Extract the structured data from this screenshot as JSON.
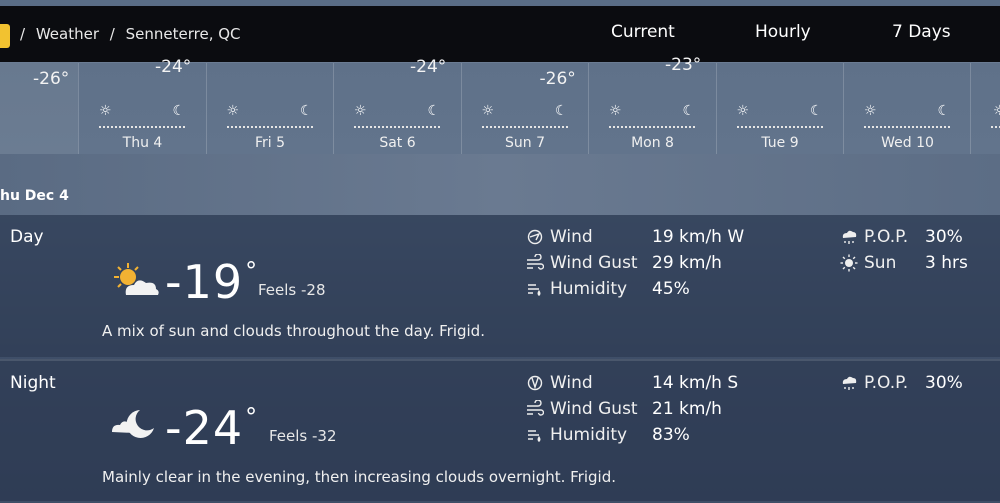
{
  "breadcrumb": {
    "separator": "/",
    "weather": "Weather",
    "location": "Senneterre, QC"
  },
  "nav": {
    "current": "Current",
    "hourly": "Hourly",
    "seven_days": "7 Days"
  },
  "strip": {
    "first_temp": "-26°",
    "days": [
      {
        "label": "Thu 4",
        "temp": "-24°",
        "temp_pos": "high"
      },
      {
        "label": "Fri 5",
        "temp": "",
        "temp_pos": "high"
      },
      {
        "label": "Sat 6",
        "temp": "-24°",
        "temp_pos": "high"
      },
      {
        "label": "Sun 7",
        "temp": "-26°",
        "temp_pos": "low"
      },
      {
        "label": "Mon 8",
        "temp": "-23°",
        "temp_pos": "top"
      },
      {
        "label": "Tue 9",
        "temp": "",
        "temp_pos": "high"
      },
      {
        "label": "Wed 10",
        "temp": "",
        "temp_pos": "high"
      }
    ]
  },
  "date_label": "hu Dec 4",
  "day": {
    "title": "Day",
    "temp": "-19",
    "degree": "°",
    "feels": "Feels -28",
    "summary": "A mix of sun and clouds throughout the day. Frigid.",
    "wind_label": "Wind",
    "wind_value": "19 km/h W",
    "gust_label": "Wind Gust",
    "gust_value": "29 km/h",
    "humidity_label": "Humidity",
    "humidity_value": "45%",
    "pop_label": "P.O.P.",
    "pop_value": "30%",
    "sun_label": "Sun",
    "sun_value": "3 hrs"
  },
  "night": {
    "title": "Night",
    "temp": "-24",
    "degree": "°",
    "feels": "Feels -32",
    "summary": "Mainly clear in the evening, then increasing clouds overnight. Frigid.",
    "wind_label": "Wind",
    "wind_value": "14 km/h S",
    "gust_label": "Wind Gust",
    "gust_value": "21 km/h",
    "humidity_label": "Humidity",
    "humidity_value": "83%",
    "pop_label": "P.O.P.",
    "pop_value": "30%"
  },
  "icons": [
    "logo-icon",
    "sun-icon",
    "moon-icon",
    "partly-cloudy-day-icon",
    "partly-cloudy-night-icon",
    "wind-icon",
    "wind-gust-icon",
    "humidity-icon",
    "pop-icon"
  ]
}
